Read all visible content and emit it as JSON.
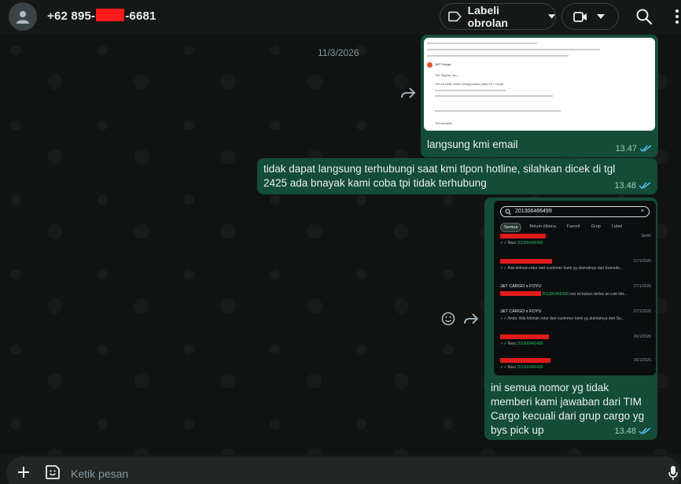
{
  "header": {
    "contact_prefix": "+62 895-",
    "contact_suffix": "-6681",
    "label_button": "Labeli obrolan",
    "icons": {
      "avatar": "default-person-icon",
      "label": "label-tag-icon",
      "video": "video-camera-icon",
      "dropdown": "chevron-down-icon",
      "search": "search-icon",
      "menu": "more-vertical-icon"
    }
  },
  "chat": {
    "date_chip": "11/3/2026",
    "messages": [
      {
        "text": "langsung kmi email",
        "time": "13.47",
        "status": "read"
      },
      {
        "text": "tidak dapat langsung terhubungi saat kmi tlpon hotline, silahkan dicek di tgl 2425 ada bnayak kami coba tpi tidak terhubung",
        "time": "13.48",
        "status": "read"
      },
      {
        "text": "ini semua nomor yg tidak memberi kami jawaban dari TIM Cargo kecuali dari grup cargo yg bys pick up",
        "time": "13.48",
        "status": "read"
      }
    ],
    "phone_screenshot": {
      "search_value": "201306466499",
      "tabs": [
        "Semua",
        "Belum dibaca",
        "Favorit",
        "Grup",
        "Label"
      ],
      "rows": [
        {
          "name": "",
          "date": "Senin",
          "sub_prefix": "Resi ",
          "sub_hl": "201306466499",
          "sub_rest": ""
        },
        {
          "name": "",
          "date": "27/1/2026",
          "sub_prefix": "Ada kiriman retur dari customer kami yg alamatnya dari Sumede...",
          "sub_hl": "",
          "sub_rest": ""
        },
        {
          "name": "J&T CARGO x FOYU",
          "date": "27/1/2026",
          "sub_prefix": "",
          "sub_hl": "201306466499",
          "sub_rest": " resi ini bukan delive an rute kite..."
        },
        {
          "name": "J&T CARGO x FOYU",
          "date": "27/1/2026",
          "sub_prefix": "Anda: Ada kiriman retur dari customer kami yg alamatnya dari Su...",
          "sub_hl": "",
          "sub_rest": ""
        },
        {
          "name": "",
          "date": "26/1/2026",
          "sub_prefix": "Resi ",
          "sub_hl": "201306466499",
          "sub_rest": ""
        },
        {
          "name": "",
          "date": "26/1/2026",
          "sub_prefix": "Resi ",
          "sub_hl": "201306466499",
          "sub_rest": ""
        }
      ]
    },
    "email_preview": {
      "sender": "J&T Cargo",
      "greeting": "Yth. Bapak / Ibu,",
      "line1": "Terima kasih telah menggunakan jasa J&T Cargo.",
      "line2": "Terima kasih"
    }
  },
  "footer": {
    "placeholder": "Ketik pesan",
    "icons": {
      "attach": "plus-icon",
      "sticker": "sticker-icon",
      "voice": "microphone-icon"
    }
  },
  "colors": {
    "bubble_out": "#144d37",
    "background": "#111313",
    "accent": "#21c063",
    "read_ticks": "#53bdeb"
  }
}
